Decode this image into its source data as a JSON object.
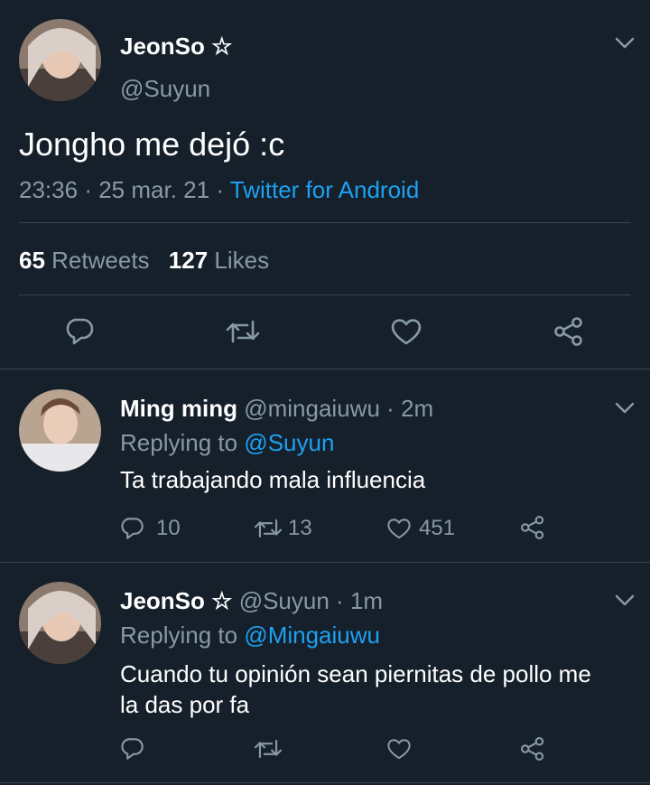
{
  "main_tweet": {
    "display_name": "JeonSo ☆",
    "handle": "@Suyun",
    "text": "Jongho me dejó :c",
    "time": "23:36",
    "date": "25 mar. 21",
    "source": "Twitter for Android",
    "retweets_count": "65",
    "retweets_label": "Retweets",
    "likes_count": "127",
    "likes_label": "Likes"
  },
  "replies": [
    {
      "display_name": "Ming ming",
      "handle": "@mingaiuwu",
      "time_ago": "2m",
      "replying_prefix": "Replying to",
      "replying_to": "@Suyun",
      "text": "Ta trabajando mala influencia",
      "reply_count": "10",
      "retweet_count": "13",
      "like_count": "451"
    },
    {
      "display_name": "JeonSo ☆",
      "handle": "@Suyun",
      "time_ago": "1m",
      "replying_prefix": "Replying to",
      "replying_to": "@Mingaiuwu",
      "text_line1": "Cuando tu opinión sean piernitas de pollo me",
      "text_line2": "la das por fa"
    }
  ],
  "separator": "·",
  "colors": {
    "background": "#15202b",
    "accent": "#1da1f2",
    "muted": "#8899a6",
    "divider": "#38444d"
  }
}
